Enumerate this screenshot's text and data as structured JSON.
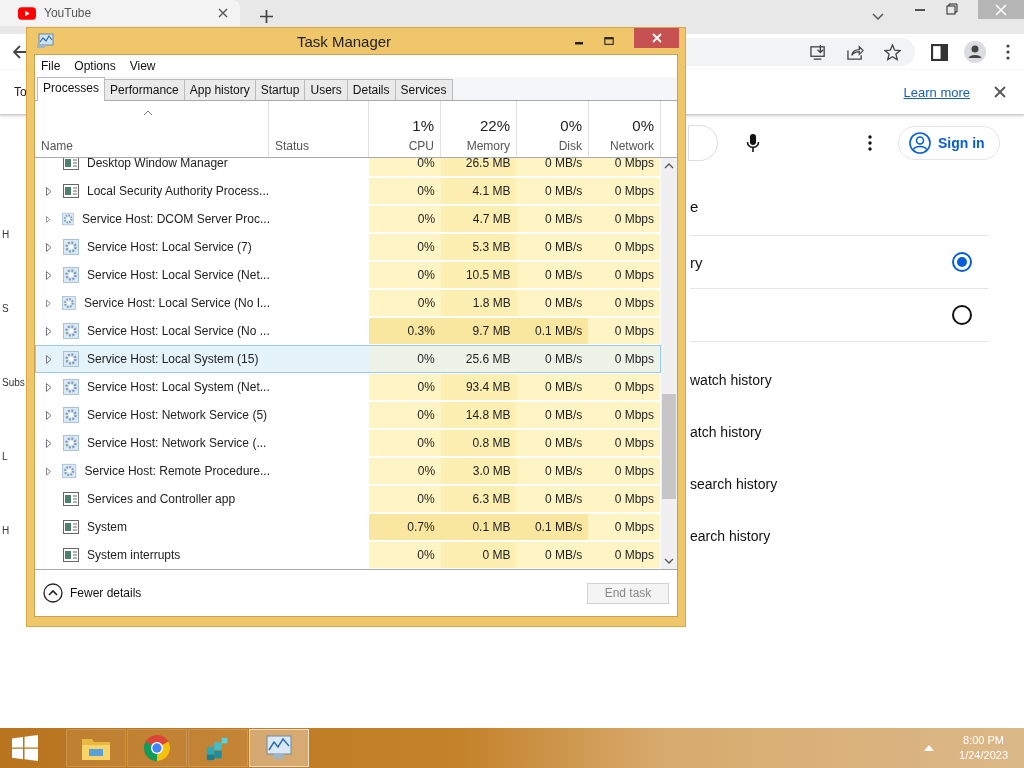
{
  "browser": {
    "tab": {
      "title": "YouTube"
    },
    "info_bar": {
      "text": "To",
      "link": "Learn more"
    },
    "page": {
      "sign_in": "Sign in",
      "left_fragments": [
        "H",
        "S",
        "Subs",
        "L",
        "H"
      ],
      "section_fragment": "e",
      "options": [
        {
          "label": "ry",
          "selected": true
        },
        {
          "selected": false
        }
      ],
      "history_fragments": [
        "watch history",
        "atch history",
        "search history",
        "earch history"
      ]
    }
  },
  "task_manager": {
    "title": "Task Manager",
    "menu": [
      "File",
      "Options",
      "View"
    ],
    "tabs": [
      {
        "label": "Processes",
        "selected": true
      },
      {
        "label": "Performance",
        "selected": false
      },
      {
        "label": "App history",
        "selected": false
      },
      {
        "label": "Startup",
        "selected": false
      },
      {
        "label": "Users",
        "selected": false
      },
      {
        "label": "Details",
        "selected": false
      },
      {
        "label": "Services",
        "selected": false
      }
    ],
    "columns": {
      "name": "Name",
      "status": "Status",
      "cpu": {
        "total": "1%",
        "label": "CPU"
      },
      "memory": {
        "total": "22%",
        "label": "Memory"
      },
      "disk": {
        "total": "0%",
        "label": "Disk"
      },
      "network": {
        "total": "0%",
        "label": "Network"
      }
    },
    "rows": [
      {
        "name": "Desktop Window Manager",
        "kind": "window",
        "expandable": false,
        "selected": false,
        "busy": false,
        "cpu": "0%",
        "memory": "26.5 MB",
        "disk": "0 MB/s",
        "network": "0 Mbps"
      },
      {
        "name": "Local Security Authority Process...",
        "kind": "window",
        "expandable": true,
        "selected": false,
        "busy": false,
        "cpu": "0%",
        "memory": "4.1 MB",
        "disk": "0 MB/s",
        "network": "0 Mbps"
      },
      {
        "name": "Service Host: DCOM Server Proc...",
        "kind": "gear",
        "expandable": true,
        "selected": false,
        "busy": false,
        "cpu": "0%",
        "memory": "4.7 MB",
        "disk": "0 MB/s",
        "network": "0 Mbps"
      },
      {
        "name": "Service Host: Local Service (7)",
        "kind": "gear",
        "expandable": true,
        "selected": false,
        "busy": false,
        "cpu": "0%",
        "memory": "5.3 MB",
        "disk": "0 MB/s",
        "network": "0 Mbps"
      },
      {
        "name": "Service Host: Local Service (Net...",
        "kind": "gear",
        "expandable": true,
        "selected": false,
        "busy": false,
        "cpu": "0%",
        "memory": "10.5 MB",
        "disk": "0 MB/s",
        "network": "0 Mbps"
      },
      {
        "name": "Service Host: Local Service (No I...",
        "kind": "gear",
        "expandable": true,
        "selected": false,
        "busy": false,
        "cpu": "0%",
        "memory": "1.8 MB",
        "disk": "0 MB/s",
        "network": "0 Mbps"
      },
      {
        "name": "Service Host: Local Service (No ...",
        "kind": "gear",
        "expandable": true,
        "selected": false,
        "busy": true,
        "cpu": "0.3%",
        "memory": "9.7 MB",
        "disk": "0.1 MB/s",
        "network": "0 Mbps"
      },
      {
        "name": "Service Host: Local System (15)",
        "kind": "gear",
        "expandable": true,
        "selected": true,
        "busy": false,
        "cpu": "0%",
        "memory": "25.6 MB",
        "disk": "0 MB/s",
        "network": "0 Mbps"
      },
      {
        "name": "Service Host: Local System (Net...",
        "kind": "gear",
        "expandable": true,
        "selected": false,
        "busy": false,
        "cpu": "0%",
        "memory": "93.4 MB",
        "disk": "0 MB/s",
        "network": "0 Mbps"
      },
      {
        "name": "Service Host: Network Service (5)",
        "kind": "gear",
        "expandable": true,
        "selected": false,
        "busy": false,
        "cpu": "0%",
        "memory": "14.8 MB",
        "disk": "0 MB/s",
        "network": "0 Mbps"
      },
      {
        "name": "Service Host: Network Service (...",
        "kind": "gear",
        "expandable": true,
        "selected": false,
        "busy": false,
        "cpu": "0%",
        "memory": "0.8 MB",
        "disk": "0 MB/s",
        "network": "0 Mbps"
      },
      {
        "name": "Service Host: Remote Procedure...",
        "kind": "gear",
        "expandable": true,
        "selected": false,
        "busy": false,
        "cpu": "0%",
        "memory": "3.0 MB",
        "disk": "0 MB/s",
        "network": "0 Mbps"
      },
      {
        "name": "Services and Controller app",
        "kind": "window",
        "expandable": false,
        "selected": false,
        "busy": false,
        "cpu": "0%",
        "memory": "6.3 MB",
        "disk": "0 MB/s",
        "network": "0 Mbps"
      },
      {
        "name": "System",
        "kind": "window",
        "expandable": false,
        "selected": false,
        "busy": true,
        "cpu": "0.7%",
        "memory": "0.1 MB",
        "disk": "0.1 MB/s",
        "network": "0 Mbps"
      },
      {
        "name": "System interrupts",
        "kind": "window",
        "expandable": false,
        "selected": false,
        "busy": false,
        "cpu": "0%",
        "memory": "0 MB",
        "disk": "0 MB/s",
        "network": "0 Mbps"
      }
    ],
    "footer": {
      "fewer_details": "Fewer details",
      "end_task": {
        "label": "End task",
        "disabled": true
      }
    }
  },
  "taskbar": {
    "time": "8:00 PM",
    "date": "1/24/2023"
  }
}
